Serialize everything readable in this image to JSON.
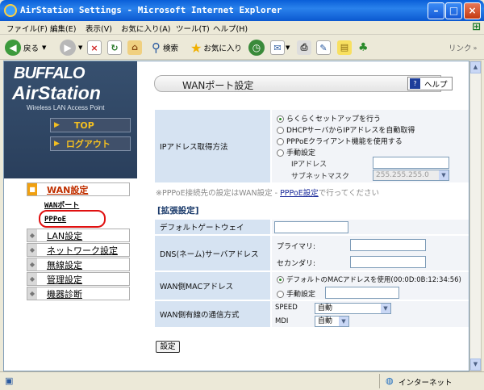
{
  "window": {
    "title": "AirStation Settings - Microsoft Internet Explorer"
  },
  "menu": [
    "ファイル(F)",
    "編集(E)",
    "表示(V)",
    "お気に入り(A)",
    "ツール(T)",
    "ヘルプ(H)"
  ],
  "toolbar": {
    "back": "戻る",
    "search": "検索",
    "favorites": "お気に入り",
    "links": "リンク"
  },
  "brand": {
    "logo": "BUFFALO",
    "product": "AirStation",
    "tagline": "Wireless LAN Access Point"
  },
  "nav": {
    "top": "TOP",
    "logout": "ログアウト"
  },
  "sidebar": {
    "wan": "WAN設定",
    "wan_port": "WANポート",
    "pppoe": "PPPoE",
    "items": [
      "LAN設定",
      "ネットワーク設定",
      "無線設定",
      "管理設定",
      "機器診断"
    ]
  },
  "page": {
    "title": "WANポート設定",
    "help": "ヘルプ"
  },
  "ip": {
    "label": "IPアドレス取得方法",
    "opt1": "らくらくセットアップを行う",
    "opt2": "DHCPサーバからIPアドレスを自動取得",
    "opt3": "PPPoEクライアント機能を使用する",
    "opt4": "手動設定",
    "ip_label": "IPアドレス",
    "mask_label": "サブネットマスク",
    "mask_value": "255.255.255.0"
  },
  "note": {
    "text": "※PPPoE接続先の設定はWAN設定 - ",
    "link": "PPPoE設定",
    "suffix": "で行ってください"
  },
  "ext": {
    "heading": "[拡張設定]",
    "gateway": "デフォルトゲートウェイ",
    "dns": "DNS(ネーム)サーバアドレス",
    "primary": "プライマリ:",
    "secondary": "セカンダリ:",
    "mac": "WAN側MACアドレス",
    "mac_default": "デフォルトのMACアドレスを使用(00:0D:0B:12:34:56)",
    "mac_manual": "手動設定",
    "wire": "WAN側有線の通信方式",
    "speed": "SPEED",
    "speed_val": "自動",
    "mdi": "MDI",
    "mdi_val": "自動"
  },
  "submit": "設定",
  "status": {
    "zone": "インターネット"
  }
}
